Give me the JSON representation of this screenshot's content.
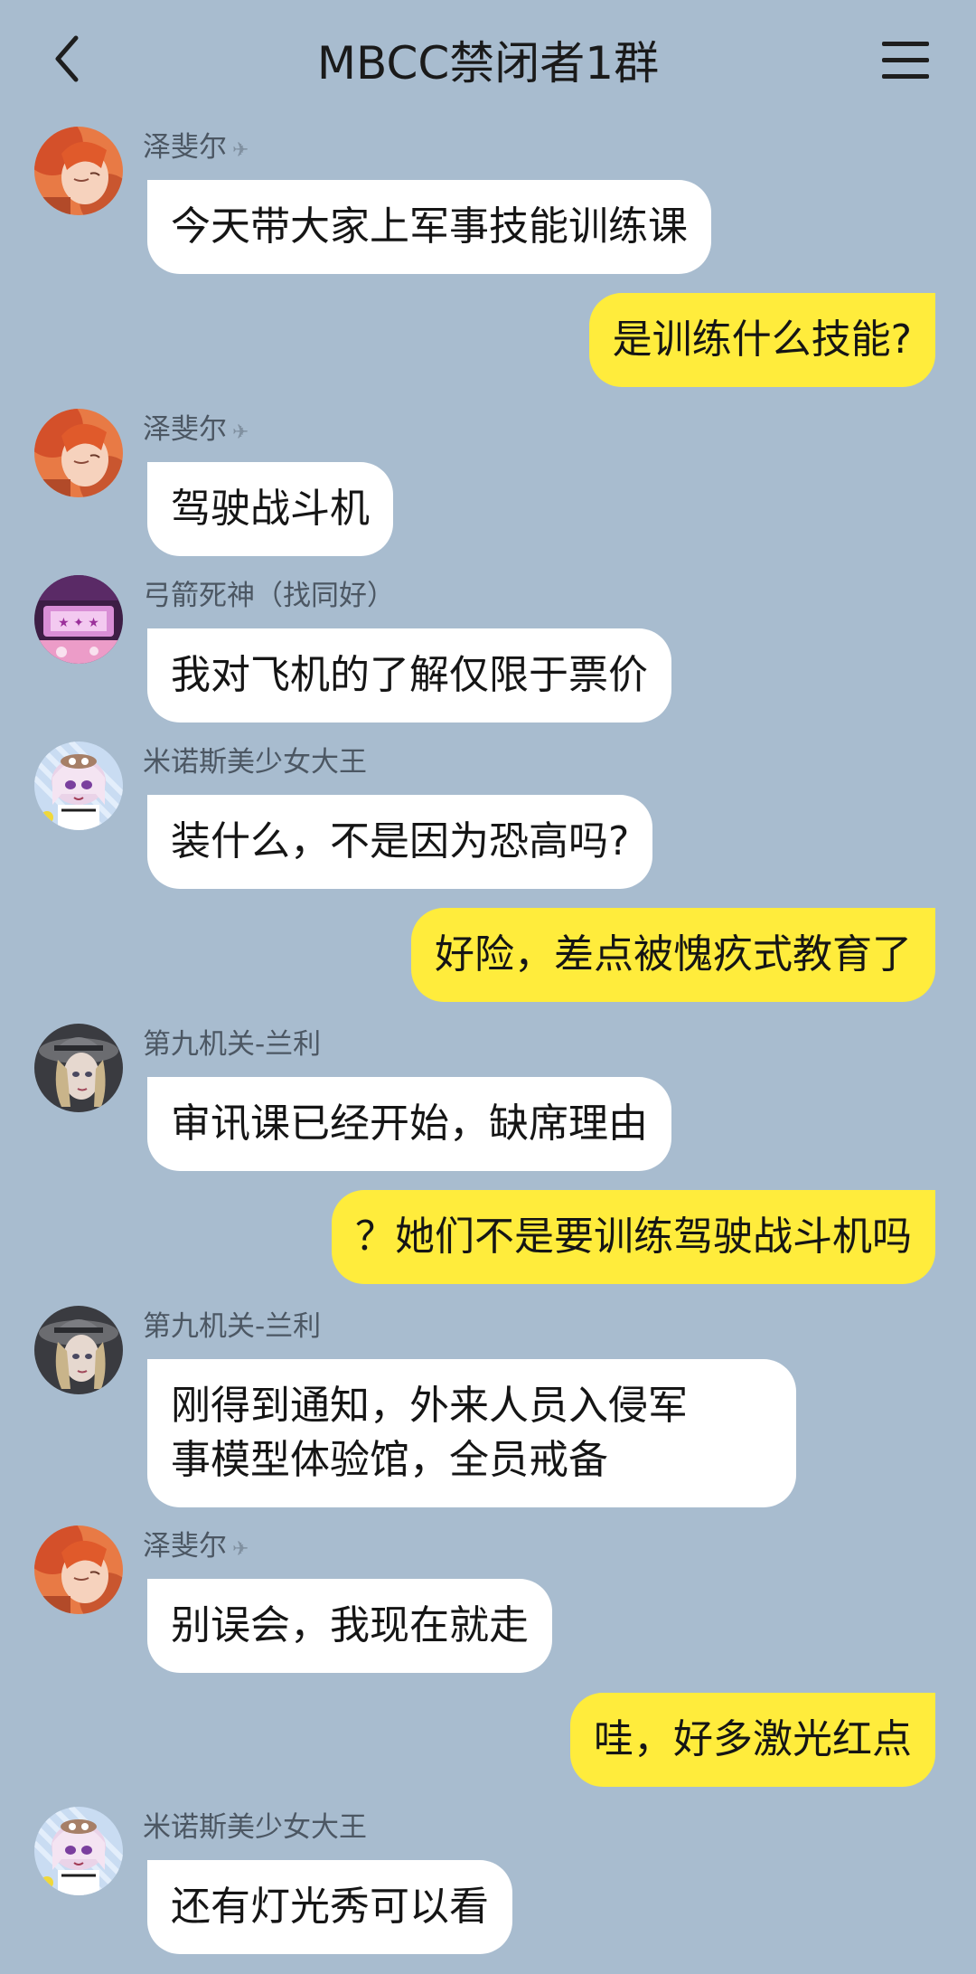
{
  "header": {
    "title": "MBCC禁闭者1群"
  },
  "icons": {
    "back": "chevron-left-icon",
    "menu": "hamburger-menu-icon",
    "badge": "fighter-jet-icon"
  },
  "colors": {
    "background": "#a8bccf",
    "incoming_bubble": "#ffffff",
    "outgoing_bubble": "#ffec3c"
  },
  "messages": [
    {
      "direction": "in",
      "sender": "泽斐尔",
      "text": "今天带大家上军事技能训练课"
    },
    {
      "direction": "out",
      "text": "是训练什么技能?"
    },
    {
      "direction": "in",
      "sender": "泽斐尔",
      "text": "驾驶战斗机"
    },
    {
      "direction": "in",
      "sender": "弓箭死神（找同好）",
      "text": "我对飞机的了解仅限于票价"
    },
    {
      "direction": "in",
      "sender": "米诺斯美少女大王",
      "text": "装什么，不是因为恐高吗?"
    },
    {
      "direction": "out",
      "text": "好险，差点被愧疚式教育了"
    },
    {
      "direction": "in",
      "sender": "第九机关-兰利",
      "text": "审讯课已经开始，缺席理由"
    },
    {
      "direction": "out",
      "text": "？她们不是要训练驾驶战斗机吗"
    },
    {
      "direction": "in",
      "sender": "第九机关-兰利",
      "lines": [
        "刚得到通知，外来人员入侵军",
        "事模型体验馆，全员戒备"
      ]
    },
    {
      "direction": "in",
      "sender": "泽斐尔",
      "text": "别误会，我现在就走"
    },
    {
      "direction": "out",
      "text": "哇，好多激光红点"
    },
    {
      "direction": "in",
      "sender": "米诺斯美少女大王",
      "text": "还有灯光秀可以看"
    }
  ]
}
